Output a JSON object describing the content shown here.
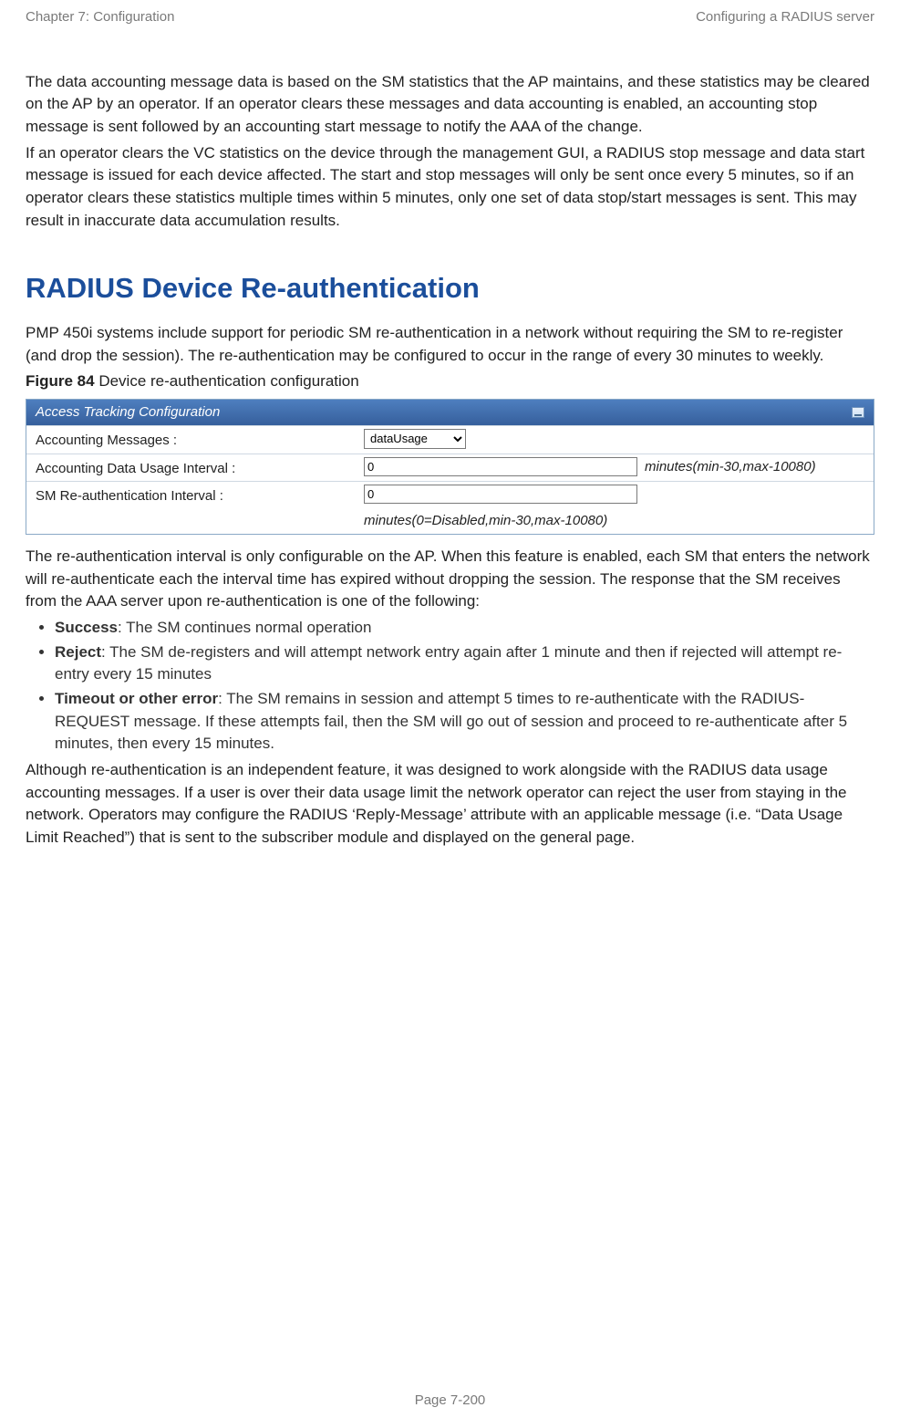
{
  "header": {
    "left": "Chapter 7:  Configuration",
    "right": "Configuring a RADIUS server"
  },
  "intro": {
    "p1": "The data accounting message data is based on the SM statistics that the AP maintains, and these statistics may be cleared on the AP by an operator.  If an operator clears these messages and data accounting is enabled, an accounting stop message is sent followed by an accounting start message to notify the AAA of the change.",
    "p2": "If an operator clears the VC statistics on the device through the management GUI, a RADIUS stop message and data start message is issued for each device affected.  The start and stop messages will only be sent once every 5 minutes, so if an operator clears these statistics multiple times within 5 minutes, only one set of data stop/start messages is sent.  This may result in inaccurate data accumulation results."
  },
  "section": {
    "title": "RADIUS Device Re-authentication",
    "p1": "PMP 450i systems include support for periodic SM re-authentication in a network without requiring the SM to re-register (and drop the session). The re-authentication may be configured to occur in the range of every 30 minutes to weekly."
  },
  "figure": {
    "label": "Figure 84",
    "caption": " Device re-authentication configuration"
  },
  "config": {
    "titlebar": "Access Tracking Configuration",
    "rows": [
      {
        "label": "Accounting Messages :",
        "type": "select",
        "value": "dataUsage",
        "hint": ""
      },
      {
        "label": "Accounting Data Usage Interval :",
        "type": "input",
        "value": "0",
        "hint": "minutes(min-30,max-10080)"
      },
      {
        "label": "SM Re-authentication Interval :",
        "type": "input",
        "value": "0",
        "hint": "minutes(0=Disabled,min-30,max-10080)"
      }
    ]
  },
  "after": {
    "p1": "The re-authentication interval is only configurable on the AP.  When this feature is enabled, each SM that enters the network will re-authenticate each the interval time has expired without dropping the session. The response that the SM receives from the AAA server upon re-authentication is one of the following:",
    "bullets": [
      {
        "b": "Success",
        "t": ": The SM continues normal operation"
      },
      {
        "b": "Reject",
        "t": ": The SM de-registers and will attempt network entry again after 1 minute and then if rejected will attempt re-entry every 15 minutes"
      },
      {
        "b": "Timeout or other error",
        "t": ": The SM remains in session and attempt 5 times to re-authenticate with the RADIUS-REQUEST message. If these attempts fail, then the SM will go out of session and proceed to re-authenticate after 5 minutes, then every 15 minutes."
      }
    ],
    "p2": "Although re-authentication is an independent feature, it was designed to work alongside with the RADIUS data usage accounting messages. If a user is over their data usage limit the network operator can reject the user from staying in the network. Operators may configure the RADIUS ‘Reply-Message’ attribute with an applicable message (i.e. “Data Usage Limit Reached”) that is sent to the subscriber module and displayed on the general page."
  },
  "footer": "Page 7-200"
}
